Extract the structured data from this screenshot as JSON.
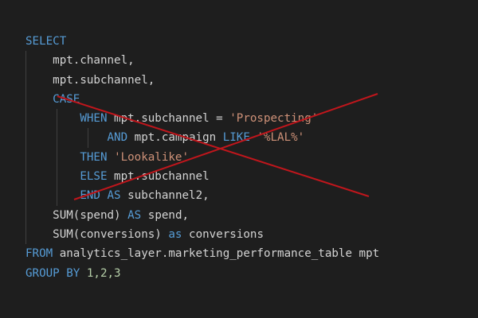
{
  "code": {
    "l1_kw": "SELECT",
    "l2_text": "mpt.channel,",
    "l3_text": "mpt.subchannel,",
    "l4_kw": "CASE",
    "l5_kw_when": "WHEN",
    "l5_text": " mpt.subchannel = ",
    "l5_str": "'Prospecting'",
    "l6_kw_and": "AND",
    "l6_text": " mpt.campaign ",
    "l6_kw_like": "LIKE",
    "l6_sp": " ",
    "l6_str": "'%LAL%'",
    "l7_kw_then": "THEN",
    "l7_sp": " ",
    "l7_str": "'Lookalike'",
    "l8_kw_else": "ELSE",
    "l8_text": " mpt.subchannel",
    "l9_kw_end": "END",
    "l9_sp": " ",
    "l9_kw_as": "AS",
    "l9_text": " subchannel2,",
    "l10_fn": "SUM(spend)",
    "l10_sp": " ",
    "l10_kw_as": "AS",
    "l10_text": " spend,",
    "l11_fn": "SUM(conversions)",
    "l11_sp": " ",
    "l11_kw_as": "as",
    "l11_text": " conversions",
    "l12_kw_from": "FROM",
    "l12_text": " analytics_layer.marketing_performance_table mpt",
    "l13_kw_group": "GROUP BY",
    "l13_sp": " ",
    "l13_num": "1,2,3"
  },
  "colors": {
    "background": "#1e1e1e",
    "keyword": "#569cd6",
    "string": "#ce9178",
    "identifier": "#d4d4d4",
    "number": "#b5cea8",
    "cross_out": "#c0161c"
  }
}
